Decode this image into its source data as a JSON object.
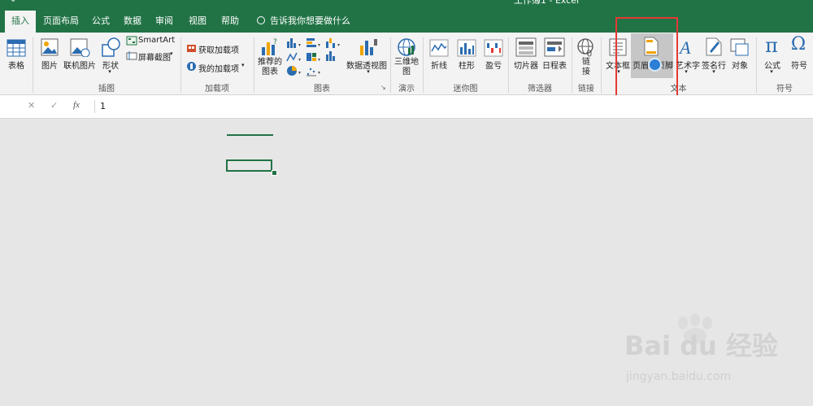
{
  "window": {
    "title": "工作簿1 - Excel",
    "qat": "⌄"
  },
  "tabs": [
    "插入",
    "页面布局",
    "公式",
    "数据",
    "审阅",
    "视图",
    "帮助"
  ],
  "tell_me": "告诉我你想要做什么",
  "ribbon": {
    "table": "表格",
    "pictures": "图片",
    "online_pictures": "联机图片",
    "shapes": "形状",
    "smartart": "SmartArt",
    "screenshot": "屏幕截图",
    "get_addins": "获取加载项",
    "my_addins": "我的加载项",
    "recommended_charts": [
      "推荐的",
      "图表"
    ],
    "pivot_chart": "数据透视图",
    "map_3d": [
      "三维地",
      "图"
    ],
    "line": "折线",
    "column": "柱形",
    "win_loss": "盈亏",
    "slicer": "切片器",
    "timeline": "日程表",
    "link": [
      "链",
      "接"
    ],
    "text_box": "文本框",
    "header_footer": "页眉和页脚",
    "wordart": "艺术字",
    "signature_line": "签名行",
    "object": "对象",
    "equation": "公式",
    "symbol": "符号"
  },
  "groups": {
    "illustrations": "插图",
    "addins": "加载项",
    "charts": "图表",
    "tours": "演示",
    "sparklines": "迷你图",
    "filters": "筛选器",
    "links": "链接",
    "text": "文本",
    "symbols": "符号"
  },
  "formula_bar": {
    "cancel": "✕",
    "enter": "✓",
    "fx": "fx",
    "value": "1"
  },
  "watermark": {
    "main": "Bai du 经验",
    "sub": "jingyan.baidu.com"
  },
  "colors": {
    "excel_green": "#217346",
    "highlight_red": "#e53935",
    "hover_gray": "#c6c6c6"
  }
}
